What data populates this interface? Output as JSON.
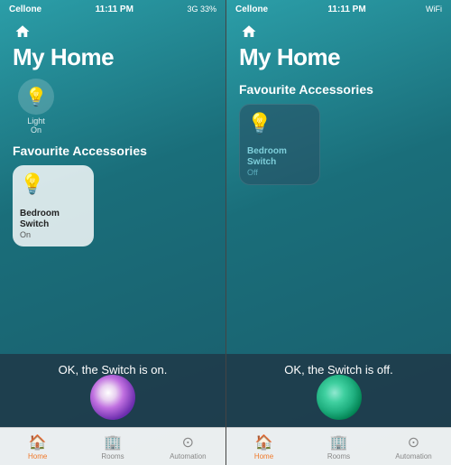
{
  "panel_left": {
    "status_bar": {
      "carrier": "Cellone",
      "time": "11:11 PM",
      "signal": "3G 33%"
    },
    "title": "My Home",
    "light": {
      "icon": "💡",
      "label": "Light",
      "status": "On"
    },
    "section": "Favourite Accessories",
    "accessory": {
      "icon": "💡",
      "name": "Bedroom Switch",
      "status": "On",
      "state": "on"
    },
    "siri_text": "OK, the Switch is on.",
    "tabs": [
      {
        "label": "Home",
        "icon": "🏠",
        "active": true
      },
      {
        "label": "Rooms",
        "icon": "🏢",
        "active": false
      },
      {
        "label": "Automation",
        "icon": "⊙",
        "active": false
      }
    ]
  },
  "panel_right": {
    "status_bar": {
      "carrier": "Cellone",
      "time": "11:11 PM",
      "signal": "WiFi"
    },
    "title": "My Home",
    "section": "Favourite Accessories",
    "accessory": {
      "icon": "💡",
      "name": "Bedroom Switch",
      "status": "Off",
      "state": "off"
    },
    "siri_text": "OK, the Switch is off.",
    "tabs": [
      {
        "label": "Home",
        "icon": "🏠",
        "active": true
      },
      {
        "label": "Rooms",
        "icon": "🏢",
        "active": false
      },
      {
        "label": "Automation",
        "icon": "⊙",
        "active": false
      }
    ]
  }
}
